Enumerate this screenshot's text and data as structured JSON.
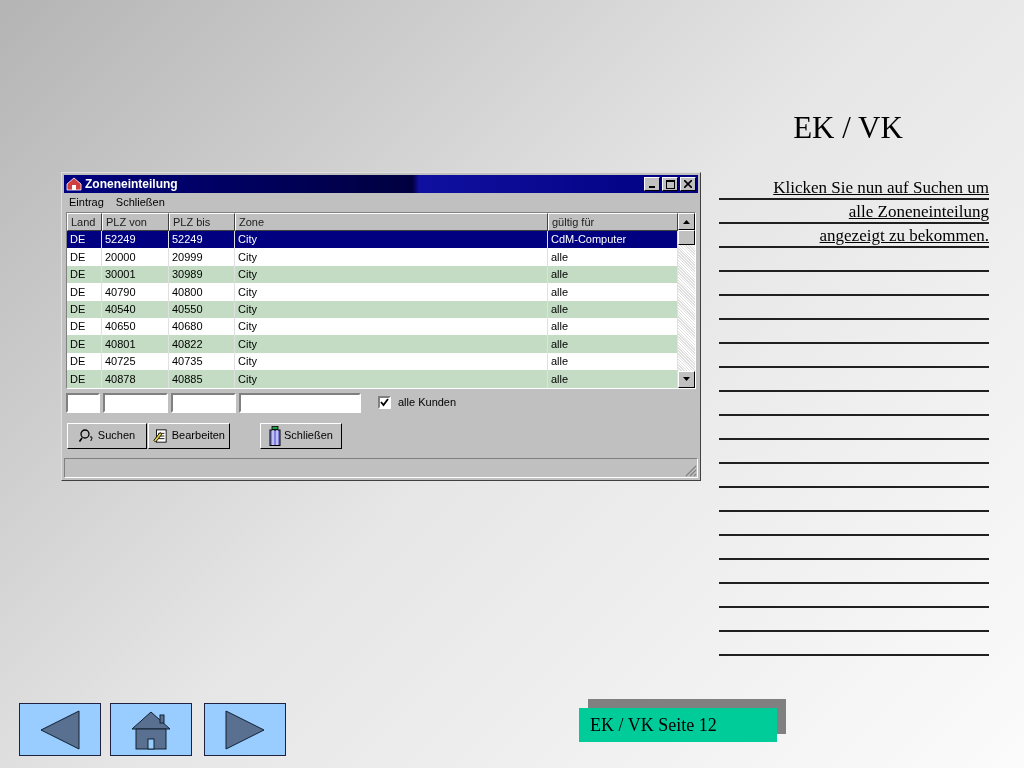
{
  "slide_title": "EK / VK",
  "window": {
    "title": "Zoneneinteilung",
    "menu": [
      "Eintrag",
      "Schließen"
    ],
    "columns": [
      "Land",
      "PLZ von",
      "PLZ bis",
      "Zone",
      "gültig für"
    ],
    "rows": [
      {
        "cells": [
          "DE",
          "52249",
          "52249",
          "City",
          "CdM-Computer"
        ],
        "selected": true
      },
      {
        "cells": [
          "DE",
          "20000",
          "20999",
          "City",
          "alle"
        ],
        "selected": false
      },
      {
        "cells": [
          "DE",
          "30001",
          "30989",
          "City",
          "alle"
        ],
        "selected": false
      },
      {
        "cells": [
          "DE",
          "40790",
          "40800",
          "City",
          "alle"
        ],
        "selected": false
      },
      {
        "cells": [
          "DE",
          "40540",
          "40550",
          "City",
          "alle"
        ],
        "selected": false
      },
      {
        "cells": [
          "DE",
          "40650",
          "40680",
          "City",
          "alle"
        ],
        "selected": false
      },
      {
        "cells": [
          "DE",
          "40801",
          "40822",
          "City",
          "alle"
        ],
        "selected": false
      },
      {
        "cells": [
          "DE",
          "40725",
          "40735",
          "City",
          "alle"
        ],
        "selected": false
      },
      {
        "cells": [
          "DE",
          "40878",
          "40885",
          "City",
          "alle"
        ],
        "selected": false
      }
    ],
    "checkbox": {
      "label": "alle Kunden",
      "checked": true
    },
    "buttons": [
      {
        "label": "Suchen",
        "kind": "search"
      },
      {
        "label": "Bearbeiten",
        "kind": "edit"
      },
      {
        "label": "Schließen",
        "kind": "close"
      }
    ]
  },
  "instructions": [
    "Klicken Sie nun auf Suchen um",
    "alle Zoneneinteilung",
    "angezeigt zu bekommen."
  ],
  "page_label": "EK / VK Seite 12"
}
